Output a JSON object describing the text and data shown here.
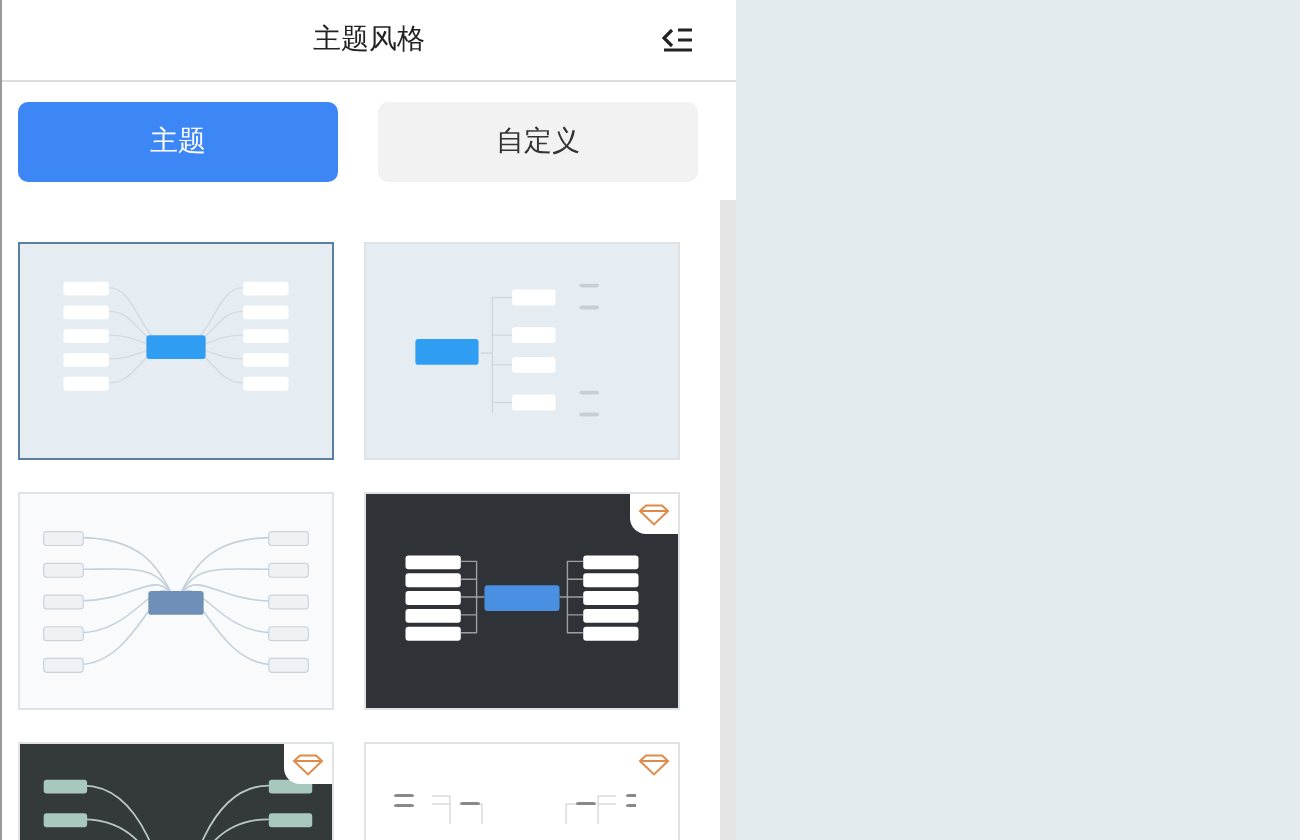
{
  "panel": {
    "title": "主题风格",
    "tabs": [
      {
        "label": "主题",
        "selected": true
      },
      {
        "label": "自定义",
        "selected": false
      }
    ]
  },
  "themes": [
    {
      "kind": "radial",
      "selected": true,
      "premium": false
    },
    {
      "kind": "tree",
      "selected": false,
      "premium": false
    },
    {
      "kind": "radial-curve",
      "selected": false,
      "premium": false
    },
    {
      "kind": "bracket",
      "selected": false,
      "premium": true
    },
    {
      "kind": "curve-dark",
      "selected": false,
      "premium": true
    },
    {
      "kind": "org",
      "selected": false,
      "premium": true
    }
  ]
}
